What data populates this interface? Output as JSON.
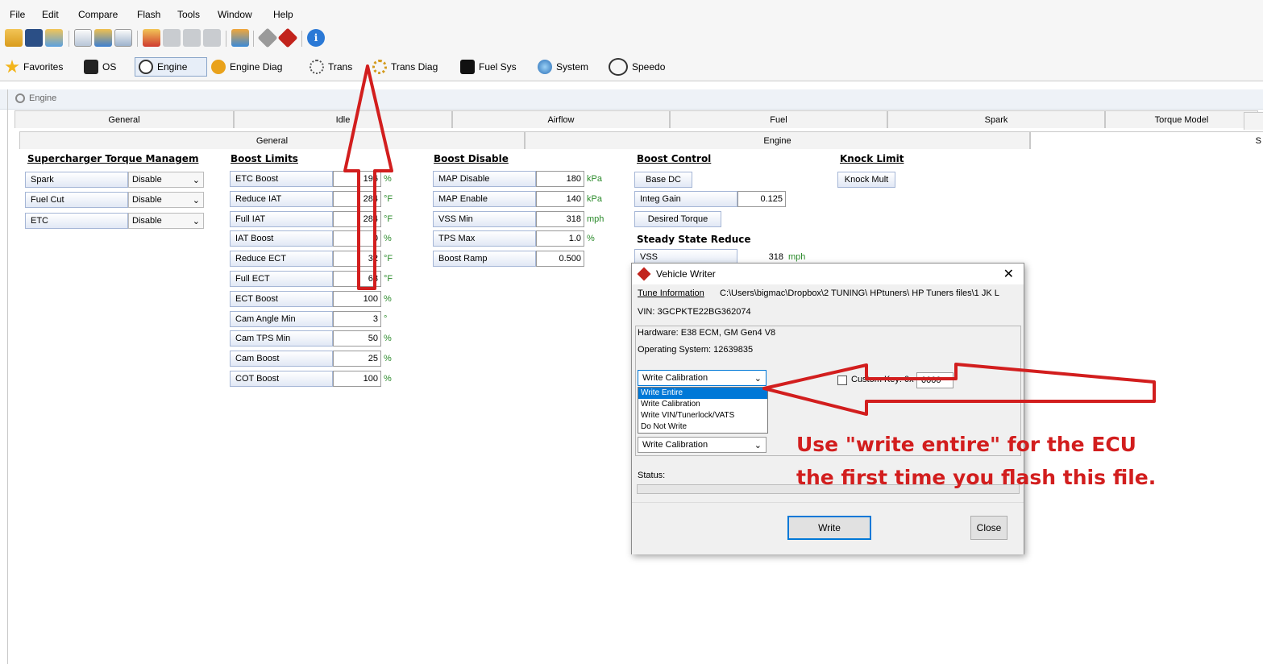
{
  "menu": [
    "File",
    "Edit",
    "Compare",
    "Flash",
    "Tools",
    "Window",
    "Help"
  ],
  "toolbar_icons": [
    "open-icon",
    "save-icon",
    "save-as-icon",
    "properties-icon",
    "user-icon",
    "info-sheet-icon",
    "folder-icon",
    "table-icon",
    "grid-icon",
    "grid-2-icon",
    "compare-icon",
    "read-vehicle-icon",
    "write-vehicle-icon",
    "info-icon"
  ],
  "nav": {
    "favorites": "Favorites",
    "os": "OS",
    "engine": "Engine",
    "engine_diag": "Engine Diag",
    "trans": "Trans",
    "trans_diag": "Trans Diag",
    "fuel_sys": "Fuel Sys",
    "system": "System",
    "speedo": "Speedo"
  },
  "editor": {
    "title": "Engine"
  },
  "tabs_main": [
    "General",
    "Idle",
    "Airflow",
    "Fuel",
    "Spark",
    "Torque Model",
    "S"
  ],
  "tabs_sub": [
    "General",
    "Engine"
  ],
  "supercharger": {
    "title": "Supercharger Torque Managem",
    "rows": [
      {
        "label": "Spark",
        "value": "Disable"
      },
      {
        "label": "Fuel Cut",
        "value": "Disable"
      },
      {
        "label": "ETC",
        "value": "Disable"
      }
    ]
  },
  "boost_limits": {
    "title": "Boost Limits",
    "rows": [
      {
        "label": "ETC Boost",
        "value": "196",
        "unit": "%"
      },
      {
        "label": "Reduce IAT",
        "value": "284",
        "unit": "°F"
      },
      {
        "label": "Full IAT",
        "value": "284",
        "unit": "°F"
      },
      {
        "label": "IAT Boost",
        "value": "0",
        "unit": "%"
      },
      {
        "label": "Reduce ECT",
        "value": "32",
        "unit": "°F"
      },
      {
        "label": "Full ECT",
        "value": "68",
        "unit": "°F"
      },
      {
        "label": "ECT Boost",
        "value": "100",
        "unit": "%"
      },
      {
        "label": "Cam Angle Min",
        "value": "3",
        "unit": "°"
      },
      {
        "label": "Cam TPS Min",
        "value": "50",
        "unit": "%"
      },
      {
        "label": "Cam Boost",
        "value": "25",
        "unit": "%"
      },
      {
        "label": "COT Boost",
        "value": "100",
        "unit": "%"
      }
    ]
  },
  "boost_disable": {
    "title": "Boost Disable",
    "rows": [
      {
        "label": "MAP Disable",
        "value": "180",
        "unit": "kPa"
      },
      {
        "label": "MAP Enable",
        "value": "140",
        "unit": "kPa"
      },
      {
        "label": "VSS Min",
        "value": "318",
        "unit": "mph"
      },
      {
        "label": "TPS Max",
        "value": "1.0",
        "unit": "%"
      },
      {
        "label": "Boost Ramp",
        "value": "0.500",
        "unit": ""
      }
    ]
  },
  "boost_control": {
    "title": "Boost Control",
    "base_dc": "Base DC",
    "integ_gain_label": "Integ Gain",
    "integ_gain_value": "0.125",
    "desired_torque": "Desired Torque",
    "steady_title": "Steady State Reduce",
    "vss_label": "VSS",
    "vss_value": "318",
    "vss_unit": "mph"
  },
  "knock_limit": {
    "title": "Knock Limit",
    "button": "Knock Mult"
  },
  "dialog": {
    "title": "Vehicle Writer",
    "tune_info_label": "Tune Information",
    "tune_path": "C:\\Users\\bigmac\\Dropbox\\2 TUNING\\ HPtuners\\ HP Tuners files\\1 JK L",
    "vin": "VIN: 3GCPKTE22BG362074",
    "hardware": "Hardware: E38 ECM, GM Gen4 V8",
    "os": "Operating System: 12639835",
    "write_combo_value": "Write Calibration",
    "options": [
      "Write Entire",
      "Write Calibration",
      "Write VIN/Tunerlock/VATS",
      "Do Not Write"
    ],
    "selected_option": "Write Entire",
    "custom_key_label": "Custom Key: 0x",
    "custom_key_value": "0000",
    "second_combo_value": "Write Calibration",
    "status_label": "Status:",
    "write_button": "Write",
    "close_button": "Close"
  },
  "annotation": {
    "line1": "Use \"write entire\" for the ECU",
    "line2": "the first time you flash this file.",
    "color": "#d21e1e"
  }
}
